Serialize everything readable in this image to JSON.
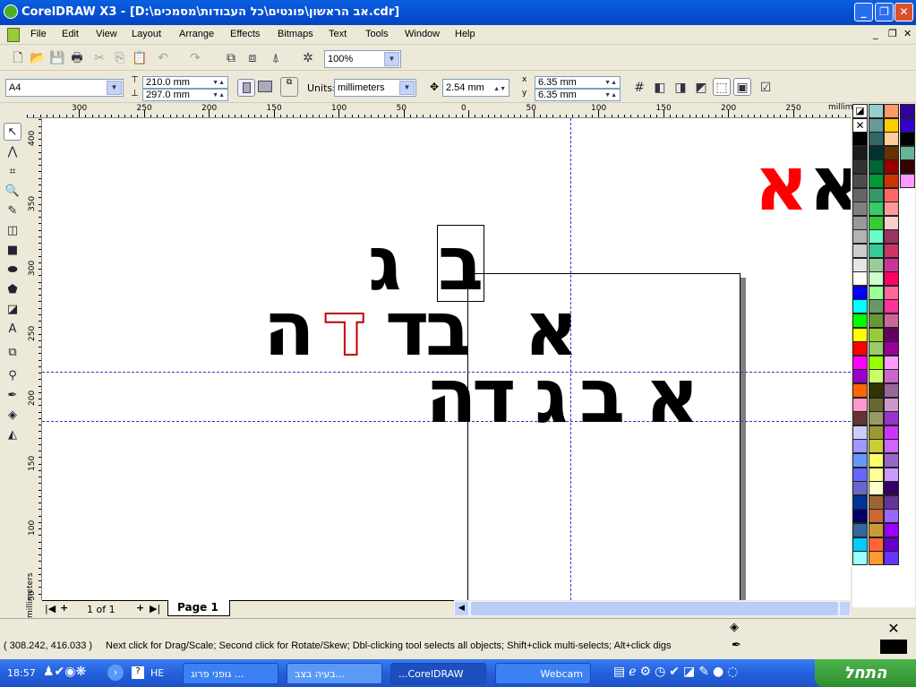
{
  "window": {
    "title": "CorelDRAW X3 - [D:\\אב הראשון\\פונטים\\כל העבודות\\מסמכים.cdr]",
    "min": "_",
    "max": "❐",
    "close": "✕"
  },
  "menu": [
    "File",
    "Edit",
    "View",
    "Layout",
    "Arrange",
    "Effects",
    "Bitmaps",
    "Text",
    "Tools",
    "Window",
    "Help"
  ],
  "toolbar": {
    "zoom": "100%"
  },
  "property_bar": {
    "page_size": "A4",
    "width": "210.0 mm",
    "height": "297.0 mm",
    "units_label": "Units:",
    "units": "millimeters",
    "nudge": "2.54 mm",
    "dup_x": "6.35 mm",
    "dup_y": "6.35 mm",
    "x_label": "x",
    "y_label": "y"
  },
  "rulers": {
    "h_labels": [
      "300",
      "250",
      "200",
      "150",
      "100",
      "50",
      "0",
      "50",
      "100",
      "150",
      "200",
      "250"
    ],
    "h_unit": "millim",
    "v_labels": [
      "400",
      "350",
      "300",
      "250",
      "200",
      "150",
      "100",
      "50"
    ],
    "v_unit": "millimeters"
  },
  "canvas": {
    "top_right": [
      "א",
      "א"
    ],
    "row1": [
      "ג",
      "ב"
    ],
    "row2": [
      "ה",
      "ד",
      "ד",
      "ב",
      "א"
    ],
    "row3": [
      "ה",
      "ד",
      "ג",
      "ב",
      "א"
    ],
    "colors": {
      "red": "#ff0000",
      "black": "#000000",
      "guide": "#3333cc"
    }
  },
  "page_nav": {
    "counter": "1 of 1",
    "tab": "Page 1",
    "first": "|◀",
    "prev": "+",
    "next": "+",
    "last": "▶|"
  },
  "palette": {
    "columns": [
      [
        "#000000",
        "#1a1a1a",
        "#333333",
        "#4d4d4d",
        "#666666",
        "#808080",
        "#999999",
        "#b3b3b3",
        "#cccccc",
        "#e6e6e6",
        "#ffffff",
        "#0000ff",
        "#00ffff",
        "#00ff00",
        "#ffff00",
        "#ff0000",
        "#ff00ff",
        "#9900cc",
        "#ff6600",
        "#ff99cc",
        "#663333",
        "#ccccff",
        "#9999ff",
        "#6699ff",
        "#6666ff",
        "#6666cc",
        "#003399",
        "#000066",
        "#336699",
        "#00ccff",
        "#99ffff"
      ],
      [
        "#99cccc",
        "#669999",
        "#336666",
        "#003333",
        "#006633",
        "#009933",
        "#339966",
        "#33cc66",
        "#33cc33",
        "#66ffcc",
        "#33cc99",
        "#99cc99",
        "#ccffcc",
        "#99ff99",
        "#669966",
        "#669933",
        "#99cc33",
        "#99cc66",
        "#99ff00",
        "#ccff66",
        "#333300",
        "#666633",
        "#999966",
        "#999933",
        "#cccc33",
        "#ffff66",
        "#ffff99",
        "#ffffcc",
        "#996633",
        "#cc6633",
        "#cc9933",
        "#ff6633",
        "#ff9933"
      ],
      [
        "#ff9966",
        "#ffcc00",
        "#ffcc99",
        "#663300",
        "#990000",
        "#cc3300",
        "#ff6666",
        "#ff9999",
        "#ffcccc",
        "#993366",
        "#cc3366",
        "#cc3399",
        "#ff0066",
        "#ff6699",
        "#ff3399",
        "#cc6699",
        "#660066",
        "#990099",
        "#ff99ff",
        "#cc66cc",
        "#996699",
        "#cc99cc",
        "#9933cc",
        "#cc33ff",
        "#cc66ff",
        "#9966cc",
        "#cc99ff",
        "#330066",
        "#663399",
        "#9966ff",
        "#9900ff",
        "#6600cc",
        "#6633ff"
      ],
      [
        "#330099",
        "#3300cc",
        "#000000",
        "#66b39a",
        "#330000",
        "#ff99ff"
      ]
    ]
  },
  "status": {
    "coords": "( 308.242, 416.033 )",
    "message": "Next click for Drag/Scale; Second click for Rotate/Skew; Dbl-clicking tool selects all objects; Shift+click multi-selects; Alt+click digs"
  },
  "taskbar": {
    "start": "התחל",
    "clock": "18:57",
    "lang": "HE",
    "tasks": [
      "גופני פרוג ...",
      "בעיה בצב...",
      "...CorelDRAW",
      "Webcam"
    ]
  }
}
